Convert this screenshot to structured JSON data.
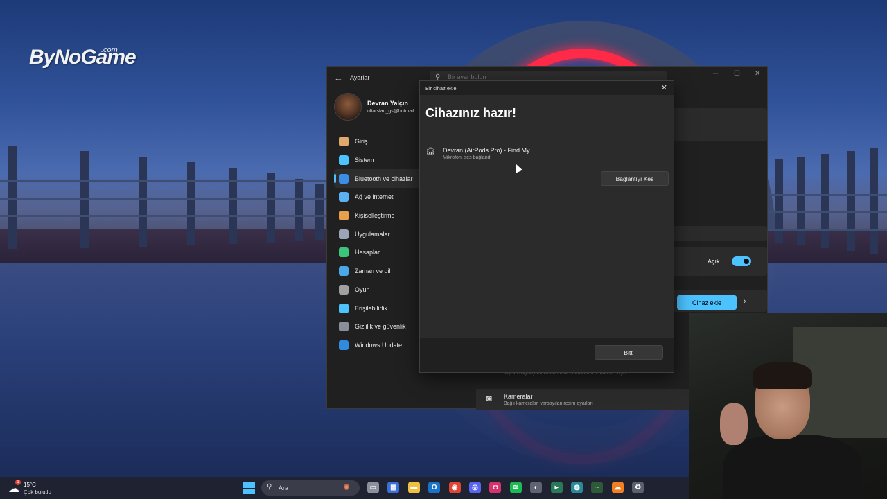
{
  "wallpaper": {
    "logo_text": "ByNoGame",
    "logo_suffix": ".com"
  },
  "settings": {
    "app_title": "Ayarlar",
    "search_placeholder": "Bir ayar bulun",
    "user": {
      "name": "Devran Yalçın",
      "email": "ultarslan_gs@hotmail"
    },
    "nav": [
      {
        "label": "Giriş",
        "icon": "home-icon",
        "color": "#e0a86a"
      },
      {
        "label": "Sistem",
        "icon": "system-icon",
        "color": "#4cc2ff"
      },
      {
        "label": "Bluetooth ve cihazlar",
        "icon": "bluetooth-icon",
        "color": "#3a8ee6",
        "active": true
      },
      {
        "label": "Ağ ve internet",
        "icon": "network-icon",
        "color": "#5ab0f0"
      },
      {
        "label": "Kişiselleştirme",
        "icon": "brush-icon",
        "color": "#e8a04a"
      },
      {
        "label": "Uygulamalar",
        "icon": "apps-icon",
        "color": "#9aa6b8"
      },
      {
        "label": "Hesaplar",
        "icon": "account-icon",
        "color": "#3cc47c"
      },
      {
        "label": "Zaman ve dil",
        "icon": "globe-icon",
        "color": "#4aa8e8"
      },
      {
        "label": "Oyun",
        "icon": "gamepad-icon",
        "color": "#a0a0a0"
      },
      {
        "label": "Erişilebilirlik",
        "icon": "accessibility-icon",
        "color": "#4cc2ff"
      },
      {
        "label": "Gizlilik ve güvenlik",
        "icon": "shield-icon",
        "color": "#8a8f9a"
      },
      {
        "label": "Windows Update",
        "icon": "update-icon",
        "color": "#2f8ae0"
      }
    ],
    "bluetooth_state": "Açık",
    "add_device_label": "Cihaz ekle",
    "mobile_desc": "Kişisel bilgisayarınızdan mobil cihazlarınıza anında erişin",
    "cameras_title": "Kameralar",
    "cameras_desc": "Bağlı kameralar, varsayılan resim ayarları"
  },
  "dialog": {
    "title": "Bir cihaz ekle",
    "heading": "Cihazınız hazır!",
    "device_name": "Devran (AirPods Pro) - Find My",
    "device_status": "Mikrofon, ses bağlandı",
    "disconnect_label": "Bağlantıyı Kes",
    "done_label": "Bitti"
  },
  "taskbar": {
    "weather_temp": "15°C",
    "weather_desc": "Çok bulutlu",
    "weather_badge": "1",
    "search_label": "Ara",
    "apps": [
      {
        "icon": "task-view-icon",
        "color": "#8c8f9c",
        "glyph": "▭"
      },
      {
        "icon": "store-icon",
        "color": "#3a6fd8",
        "glyph": "▦"
      },
      {
        "icon": "file-explorer-icon",
        "color": "#f0c040",
        "glyph": "▬"
      },
      {
        "icon": "outlook-icon",
        "color": "#1a73c8",
        "glyph": "O"
      },
      {
        "icon": "chrome-icon",
        "color": "#e04434",
        "glyph": "◉"
      },
      {
        "icon": "discord-icon",
        "color": "#5865f2",
        "glyph": "◎"
      },
      {
        "icon": "instagram-icon",
        "color": "#d6336c",
        "glyph": "◘"
      },
      {
        "icon": "spotify-icon",
        "color": "#1db954",
        "glyph": "≋"
      },
      {
        "icon": "app-tool-icon",
        "color": "#606470",
        "glyph": "◐"
      },
      {
        "icon": "terminal-icon",
        "color": "#2a7a5a",
        "glyph": "▸"
      },
      {
        "icon": "network-monitor-icon",
        "color": "#2a8a9a",
        "glyph": "◍"
      },
      {
        "icon": "steam-icon",
        "color": "#2e5a3a",
        "glyph": "~"
      },
      {
        "icon": "cloudflare-icon",
        "color": "#f38020",
        "glyph": "☁"
      },
      {
        "icon": "settings-gear-icon",
        "color": "#5a6070",
        "glyph": "⚙"
      }
    ]
  }
}
